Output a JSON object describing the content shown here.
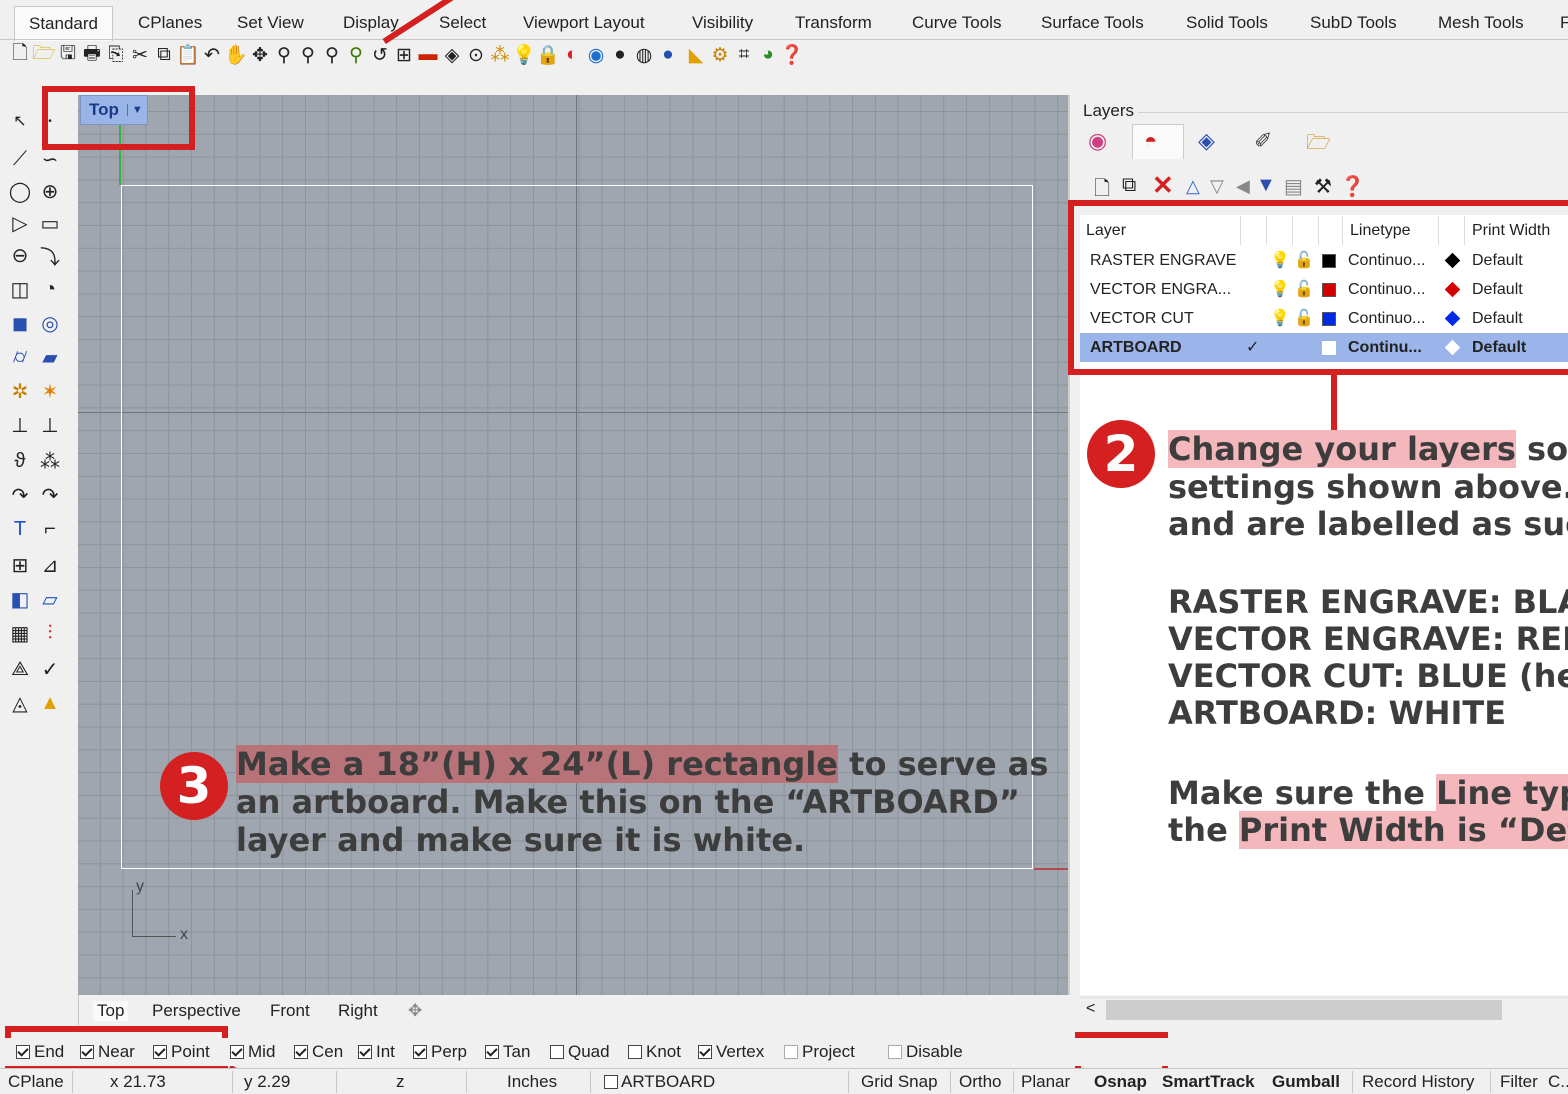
{
  "tabs": [
    "Standard",
    "CPlanes",
    "Set View",
    "Display",
    "Select",
    "Viewport Layout",
    "Visibility",
    "Transform",
    "Curve Tools",
    "Surface Tools",
    "Solid Tools",
    "SubD Tools",
    "Mesh Tools",
    "F"
  ],
  "viewport": {
    "label": "Top",
    "dropdown": "▼",
    "tabs": [
      "Top",
      "Perspective",
      "Front",
      "Right"
    ],
    "add_icon": "✥",
    "axis_x": "x",
    "axis_y": "y"
  },
  "layers": {
    "title": "Layers",
    "headers": {
      "layer": "Layer",
      "linetype": "Linetype",
      "print_width": "Print Width"
    },
    "rows": [
      {
        "name": "RASTER ENGRAVE",
        "linetype": "Continuo...",
        "print_width": "Default",
        "color": "#000000"
      },
      {
        "name": "VECTOR ENGRA...",
        "linetype": "Continuo...",
        "print_width": "Default",
        "color": "#d40000"
      },
      {
        "name": "VECTOR CUT",
        "linetype": "Continuo...",
        "print_width": "Default",
        "color": "#0028e6"
      },
      {
        "name": "ARTBOARD",
        "current": "✓",
        "linetype": "Continu...",
        "print_width": "Default",
        "color": "#ffffff"
      }
    ],
    "scroll_left": "<"
  },
  "annotations": {
    "step2": {
      "num": "2",
      "line1_hl": "Change your layers",
      "line1_rest": " so t",
      "line2": "settings shown above. M",
      "line3": "and are labelled as such",
      "list": [
        "RASTER ENGRAVE: BLA",
        "VECTOR ENGRAVE: RED",
        "VECTOR CUT: BLUE (hex",
        "ARTBOARD: WHITE"
      ],
      "line4_pre": "Make sure the ",
      "line4_hl": "Line type",
      "line5_pre": "the ",
      "line5_hl": "Print Width is “Defa"
    },
    "step3": {
      "num": "3",
      "line1_hl": "Make a 18”(H) x 24”(L) rectangle",
      "line1_rest": " to serve as",
      "line2": "an artboard. Make this on the “ARTBOARD”",
      "line3": "layer and make sure it is white."
    }
  },
  "osnaps": [
    {
      "label": "End",
      "checked": true
    },
    {
      "label": "Near",
      "checked": true
    },
    {
      "label": "Point",
      "checked": true
    },
    {
      "label": "Mid",
      "checked": true
    },
    {
      "label": "Cen",
      "checked": true
    },
    {
      "label": "Int",
      "checked": true
    },
    {
      "label": "Perp",
      "checked": true
    },
    {
      "label": "Tan",
      "checked": true
    },
    {
      "label": "Quad",
      "checked": false
    },
    {
      "label": "Knot",
      "checked": false
    },
    {
      "label": "Vertex",
      "checked": true
    },
    {
      "label": "Project",
      "checked": false
    },
    {
      "label": "Disable",
      "checked": false
    }
  ],
  "status": {
    "cplane": "CPlane",
    "x": "x 21.73",
    "y": "y 2.29",
    "z": "z",
    "units": "Inches",
    "layer": "ARTBOARD",
    "grid_snap": "Grid Snap",
    "ortho": "Ortho",
    "planar": "Planar",
    "osnap": "Osnap",
    "smarttrack": "SmartTrack",
    "gumball": "Gumball",
    "record_history": "Record History",
    "filter": "Filter",
    "extra": "C..."
  }
}
